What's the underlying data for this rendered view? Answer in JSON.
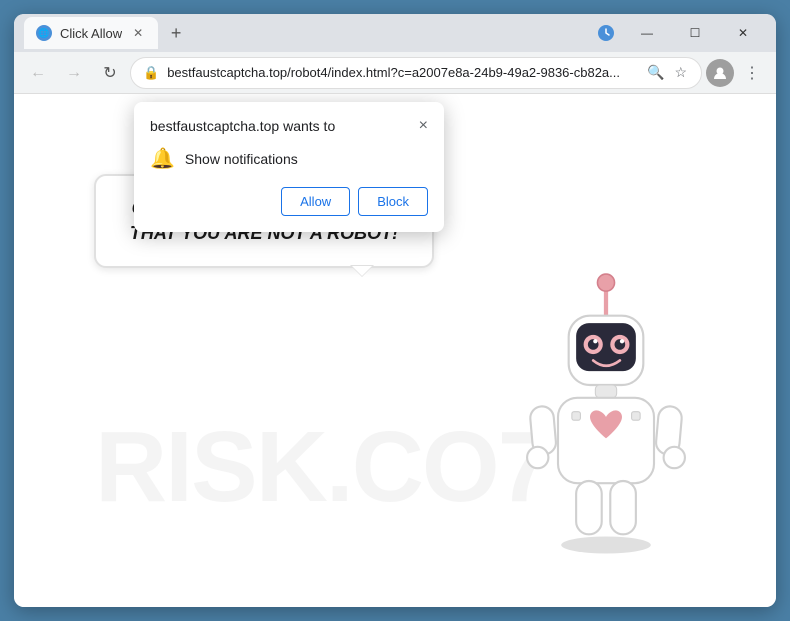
{
  "browser": {
    "tab": {
      "label": "Click Allow",
      "icon": "🌐"
    },
    "address": "bestfaustcaptcha.top/robot4/index.html?c=a2007e8a-24b9-49a2-9836-cb82a...",
    "new_tab_label": "+",
    "controls": {
      "minimize": "—",
      "maximize": "☐",
      "close": "✕"
    }
  },
  "popup": {
    "title": "bestfaustcaptcha.top wants to",
    "description": "Show notifications",
    "allow_label": "Allow",
    "block_label": "Block",
    "close_label": "×"
  },
  "page": {
    "bubble_text": "CLICK «ALLOW» TO CONFIRM THAT YOU ARE NOT A ROBOT!",
    "watermark": "RISK.CO7"
  }
}
